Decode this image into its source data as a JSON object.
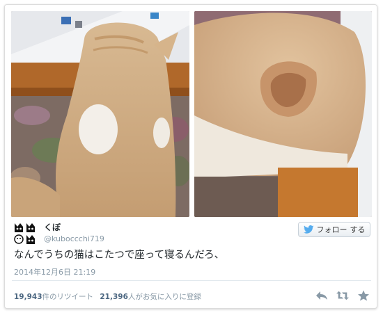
{
  "colors": {
    "card_border": "#dcdcdc",
    "text_primary": "#292f33",
    "text_secondary": "#8899a6",
    "stat_number": "#4c6781",
    "twitter_blue": "#55acee",
    "icon_gray": "#8899a6"
  },
  "tweet": {
    "author": {
      "display_name": "くぼ",
      "screen_name": "@kuboccchi719",
      "avatar_icon": "cat-faces-avatar"
    },
    "follow_button": {
      "label": "フォロー",
      "label_suffix": "する",
      "icon": "twitter-bird-icon"
    },
    "text": "なんでうちの猫はこたつで座って寝るんだろ、",
    "timestamp": "2014年12月6日  21:19",
    "stats": {
      "retweets_count": "19,943",
      "retweets_label": "件のリツイート",
      "favorites_count": "21,396",
      "favorites_label": "人がお気に入りに登録"
    },
    "actions": [
      {
        "name": "reply",
        "icon": "reply-icon"
      },
      {
        "name": "retweet",
        "icon": "retweet-icon"
      },
      {
        "name": "favorite",
        "icon": "star-icon"
      }
    ],
    "photos": [
      {
        "icon": "photo",
        "subject": "orange-white cat sitting on kotatsu"
      },
      {
        "icon": "photo",
        "subject": "close-up of cat head and ear"
      }
    ]
  }
}
